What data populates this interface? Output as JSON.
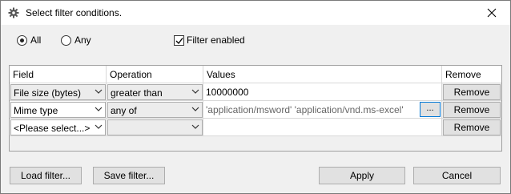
{
  "window": {
    "title": "Select filter conditions."
  },
  "match": {
    "all_label": "All",
    "any_label": "Any",
    "selected": "All"
  },
  "filter_enabled": {
    "label": "Filter enabled",
    "checked": true
  },
  "table": {
    "headers": {
      "field": "Field",
      "operation": "Operation",
      "values": "Values",
      "remove": "Remove"
    },
    "rows": [
      {
        "field": "File size (bytes)",
        "operation": "greater than",
        "values": "10000000",
        "remove": "Remove"
      },
      {
        "field": "Mime type",
        "operation": "any of",
        "values": "'application/msword' 'application/vnd.ms-excel'",
        "browse": "...",
        "remove": "Remove"
      },
      {
        "field": "<Please select...>",
        "operation": "",
        "values": "",
        "remove": "Remove"
      }
    ]
  },
  "buttons": {
    "load": "Load filter...",
    "save": "Save filter...",
    "apply": "Apply",
    "cancel": "Cancel"
  },
  "icons": {
    "app": "gear-icon",
    "close": "close-icon",
    "dropdown": "chevron-down-icon",
    "check": "checkmark-icon"
  }
}
